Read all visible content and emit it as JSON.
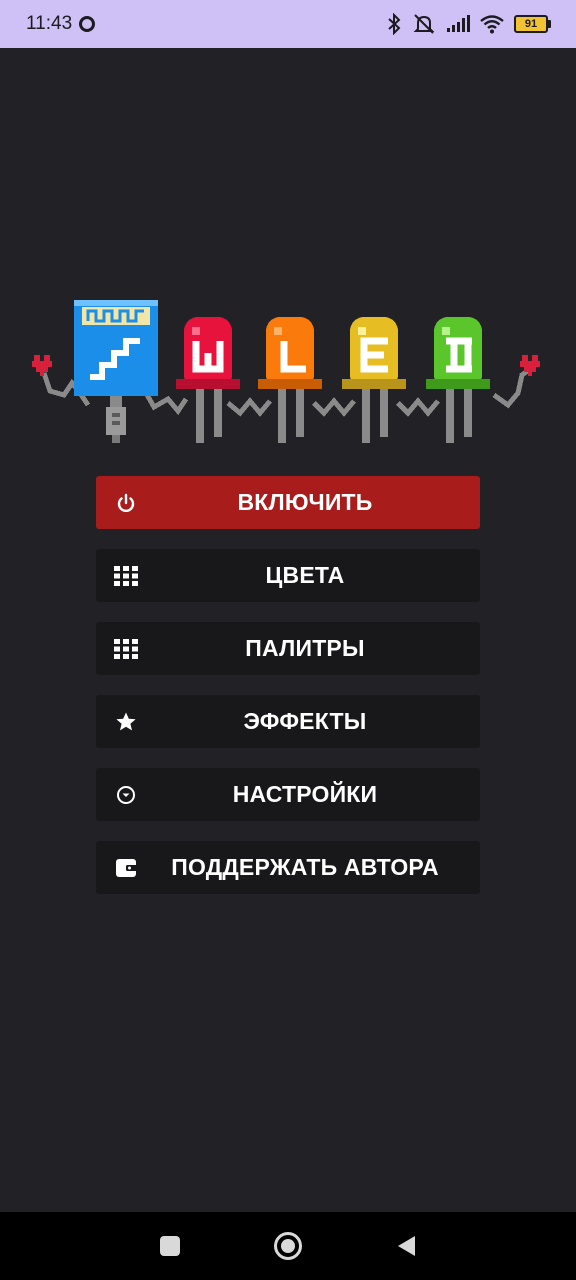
{
  "status_bar": {
    "time": "11:43",
    "battery": "91",
    "icons": [
      "record-icon",
      "bluetooth-icon",
      "mute-icon",
      "signal-icon",
      "wifi-icon",
      "battery-icon"
    ]
  },
  "logo": {
    "icons": [
      "microcontroller-icon",
      "led-w-icon",
      "led-l-icon",
      "led-e-icon",
      "led-d-icon",
      "heart-icon"
    ],
    "colors": {
      "blue": "#1a8ee8",
      "red": "#e8133c",
      "orange": "#fb7a0c",
      "yellow": "#e6bd22",
      "green": "#5ac62c",
      "wire": "#8a8a8a",
      "heart": "#d8203c"
    }
  },
  "menu": {
    "items": [
      {
        "label": "ВКЛЮЧИТЬ",
        "icon": "power-icon",
        "accent": "#a81c1c"
      },
      {
        "label": "ЦВЕТА",
        "icon": "grid-icon"
      },
      {
        "label": "ПАЛИТРЫ",
        "icon": "grid-icon"
      },
      {
        "label": "ЭФФЕКТЫ",
        "icon": "star-icon"
      },
      {
        "label": "НАСТРОЙКИ",
        "icon": "chevron-circle-icon"
      },
      {
        "label": "ПОДДЕРЖАТЬ АВТОРА",
        "icon": "wallet-icon"
      }
    ]
  },
  "nav_bar": {
    "icons": [
      "recents-icon",
      "home-icon",
      "back-icon"
    ]
  }
}
